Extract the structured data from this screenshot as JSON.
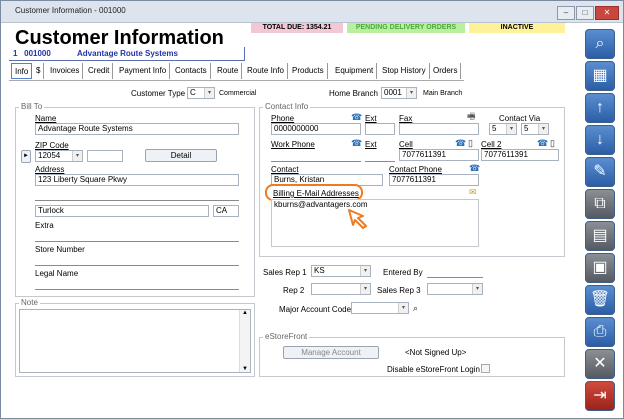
{
  "window": {
    "title": "Customer Information - 001000"
  },
  "status": {
    "total_due": "TOTAL DUE: 1354.21",
    "pending": "PENDING DELIVERY ORDERS",
    "inactive": "INACTIVE",
    "colors": {
      "total_due_bg": "#f3c8d6",
      "pending_bg": "#b8f0a0",
      "inactive_bg": "#fdf29a"
    }
  },
  "header": {
    "title": "Customer Information",
    "seq": "1",
    "customer_no": "001000",
    "customer_name": "Advantage Route Systems"
  },
  "tabs": [
    "Info",
    "$",
    "Invoices",
    "Credit",
    "Payment Info",
    "Contacts",
    "Route",
    "Route Info",
    "Products",
    "Equipment",
    "Stop History",
    "Orders"
  ],
  "customer_type": {
    "label": "Customer Type",
    "value": "C",
    "desc": "Commercial"
  },
  "home_branch": {
    "label": "Home Branch",
    "value": "0001",
    "desc": "Main Branch"
  },
  "bill_to": {
    "group": "Bill To",
    "name_label": "Name",
    "name": "Advantage Route Systems",
    "zip_label": "ZIP Code",
    "zip": "12054",
    "detail_button": "Detail",
    "address_label": "Address",
    "address1": "123 Liberty Square Pkwy",
    "address2": "",
    "city": "Turlock",
    "state": "CA",
    "extra_label": "Extra",
    "store_label": "Store Number",
    "legal_label": "Legal Name"
  },
  "note": {
    "group": "Note"
  },
  "contact": {
    "group": "Contact Info",
    "phone_label": "Phone",
    "phone": "0000000000",
    "ext_label": "Ext",
    "fax_label": "Fax",
    "contact_via_label": "Contact Via",
    "via1": "5",
    "via2": "5",
    "work_phone_label": "Work Phone",
    "ext2_label": "Ext",
    "cell_label": "Cell",
    "cell": "7077611391",
    "cell2_label": "Cell 2",
    "cell2": "7077611391",
    "contact_label": "Contact",
    "contact": "Burns, Kristan",
    "contact_phone_label": "Contact Phone",
    "contact_phone": "7077611391",
    "billing_email_label": "Billing E-Mail Addresses",
    "billing_email": "kburns@advantagers.com"
  },
  "sales": {
    "rep1_label": "Sales Rep 1",
    "rep1": "KS",
    "entered_by_label": "Entered By",
    "rep2_label": "Rep 2",
    "rep3_label": "Sales Rep 3",
    "major_label": "Major Account Code"
  },
  "estore": {
    "group": "eStoreFront",
    "manage_button": "Manage Account",
    "status": "<Not Signed Up>",
    "disable_label": "Disable eStoreFront Login"
  },
  "toolbar": [
    "search-icon",
    "grid-icon",
    "up-arrow-icon",
    "down-arrow-icon",
    "edit-icon",
    "copy-icon",
    "new-icon",
    "save-icon",
    "delete-icon",
    "print-icon",
    "close-icon",
    "exit-icon"
  ]
}
